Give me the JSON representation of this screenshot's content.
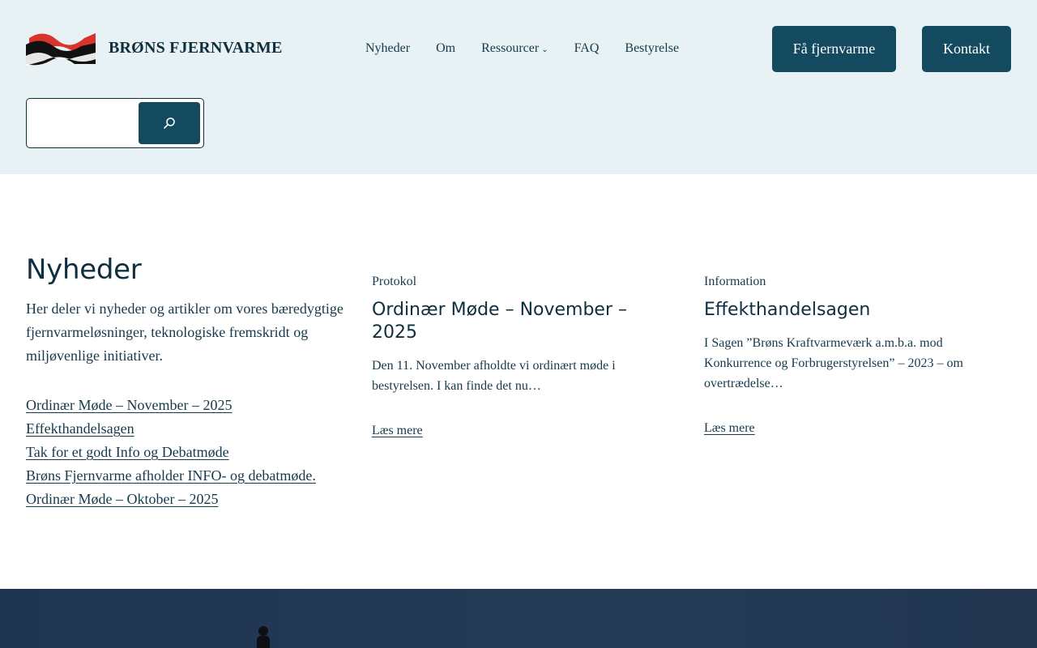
{
  "brand": {
    "name": "BRØNS FJERNVARME"
  },
  "nav": {
    "items": [
      {
        "label": "Nyheder"
      },
      {
        "label": "Om"
      },
      {
        "label": "Ressourcer"
      },
      {
        "label": "FAQ"
      },
      {
        "label": "Bestyrelse"
      }
    ]
  },
  "header_buttons": {
    "join": "Få fjernvarme",
    "contact": "Kontakt"
  },
  "search": {
    "value": "",
    "icon": "search-icon"
  },
  "news": {
    "title": "Nyheder",
    "intro": "Her deler vi nyheder og artikler om vores bæredygtige fjernvarmeløsninger, teknologiske fremskridt og miljøvenlige initiativer.",
    "links": [
      "Ordinær Møde – November – 2025",
      "Effekthandelsagen",
      "Tak for et godt Info og Debatmøde",
      "Brøns Fjernvarme afholder INFO- og debatmøde.",
      "Ordinær Møde – Oktober – 2025"
    ]
  },
  "cards": [
    {
      "category": "Protokol",
      "title": "Ordinær Møde – November – 2025",
      "excerpt": "Den 11. November afholdte vi ordinært møde i bestyrelsen. I kan finde det nu…",
      "more": "Læs mere"
    },
    {
      "category": "Information",
      "title": "Effekthandelsagen",
      "excerpt": "I Sagen ”Brøns Kraftvarmeværk a.m.b.a. mod Konkurrence og Forbrugerstyrelsen” – 2023 – om overtrædelse…",
      "more": "Læs mere"
    }
  ],
  "colors": {
    "header_bg": "#e8f1f4",
    "accent": "#134a5f",
    "text": "#163a4a",
    "logo_red": "#d9332b",
    "footer_bg": "#223650"
  }
}
